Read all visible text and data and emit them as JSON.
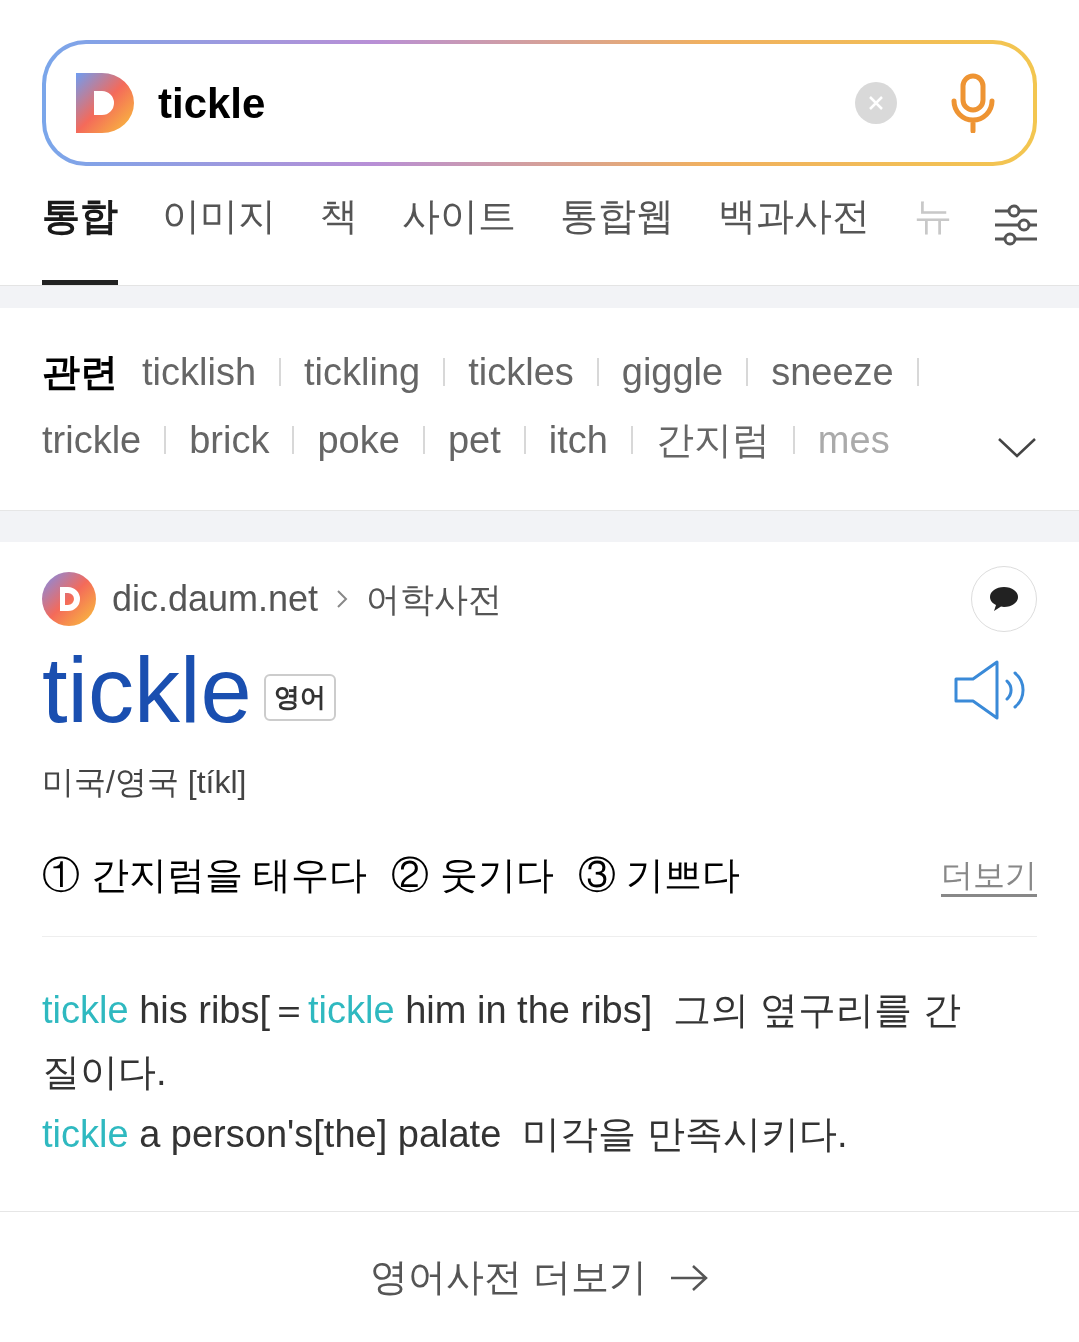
{
  "search": {
    "value": "tickle"
  },
  "tabs": [
    {
      "label": "통합",
      "selected": true
    },
    {
      "label": "이미지",
      "selected": false
    },
    {
      "label": "책",
      "selected": false
    },
    {
      "label": "사이트",
      "selected": false
    },
    {
      "label": "통합웹",
      "selected": false
    },
    {
      "label": "백과사전",
      "selected": false
    },
    {
      "label": "뉴",
      "selected": false
    }
  ],
  "related": {
    "label": "관련",
    "terms": [
      "ticklish",
      "tickling",
      "tickles",
      "giggle",
      "sneeze",
      "trickle",
      "brick",
      "poke",
      "pet",
      "itch",
      "간지럼",
      "mes"
    ]
  },
  "result": {
    "site": "dic.daum.net",
    "section": "어학사전",
    "word": "tickle",
    "language": "영어",
    "pronunciation": "미국/영국 [tíkl]",
    "meanings": [
      {
        "number": "①",
        "text": "간지럼을 태우다"
      },
      {
        "number": "②",
        "text": "웃기다"
      },
      {
        "number": "③",
        "text": "기쁘다"
      }
    ],
    "more": "더보기",
    "examples": [
      [
        {
          "text": "tickle",
          "highlight": true
        },
        {
          "text": " his ribs[＝",
          "highlight": false
        },
        {
          "text": "tickle",
          "highlight": true
        },
        {
          "text": " him in the ribs]  그의 옆구리를 간질이다.",
          "highlight": false
        }
      ],
      [
        {
          "text": "tickle",
          "highlight": true
        },
        {
          "text": " a person's[the] palate  미각을 만족시키다.",
          "highlight": false
        }
      ]
    ],
    "footer_link": "영어사전 더보기"
  }
}
